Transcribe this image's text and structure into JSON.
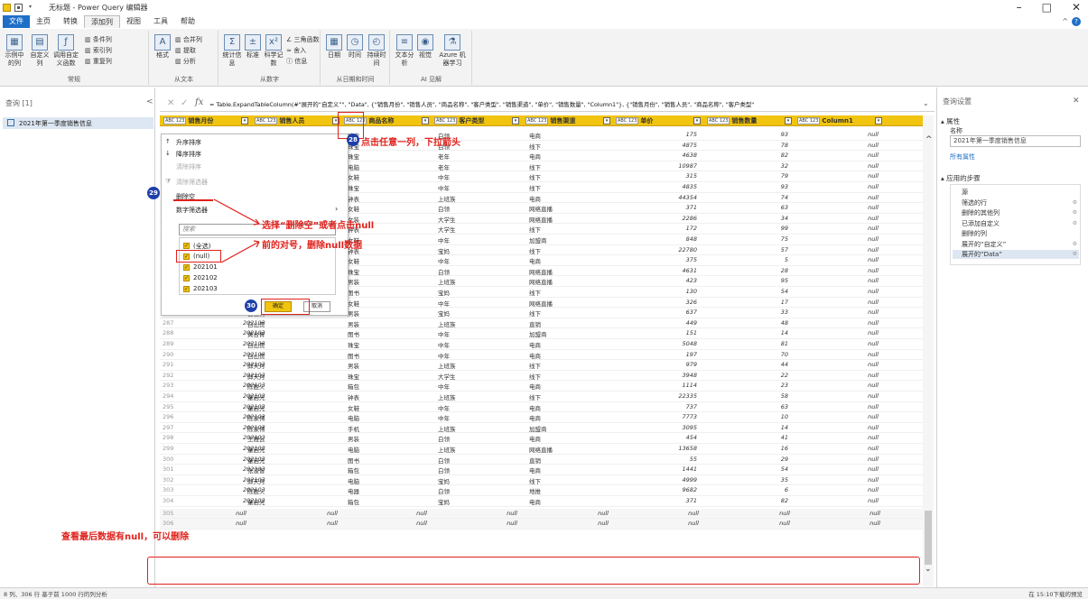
{
  "window": {
    "title": "无标题 - Power Query 编辑器",
    "minimize": "–",
    "maximize": "□",
    "close": "✕"
  },
  "menu": {
    "tabs": [
      "文件",
      "主页",
      "转换",
      "添加列",
      "视图",
      "工具",
      "帮助"
    ],
    "help_icon": "?",
    "collapse_icon": "^"
  },
  "ribbon": {
    "groups": [
      {
        "label": "常规",
        "buttons": [
          "示例中的列",
          "自定义列",
          "调用自定义函数",
          "条件列",
          "索引列",
          "重复列"
        ]
      },
      {
        "label": "从文本",
        "buttons": [
          "格式",
          "合并列",
          "提取",
          "分析"
        ]
      },
      {
        "label": "从数字",
        "buttons": [
          "统计信息",
          "标准",
          "科学记数",
          "三角函数",
          "舍入",
          "信息"
        ]
      },
      {
        "label": "从日期和时间",
        "buttons": [
          "日期",
          "时间",
          "持续时间"
        ]
      },
      {
        "label": "AI 见解",
        "buttons": [
          "文本分析",
          "视觉",
          "Azure 机器学习"
        ]
      }
    ]
  },
  "queries_panel": {
    "title": "查询 [1]",
    "collapse": "<",
    "items": [
      "2021年第一季度销售信息"
    ]
  },
  "formula_bar": {
    "cancel": "✕",
    "confirm": "✓",
    "fx": "fx",
    "text": "= Table.ExpandTableColumn(#\"展开的“自定义”\", \"Data\", {\"销售月份\", \"销售人员\", \"商品名称\", \"客户类型\", \"销售渠道\", \"单价\", \"销售数量\", \"Column1\"}, {\"销售月份\", \"销售人员\", \"商品名称\", \"客户类型\"",
    "expand": "⌄"
  },
  "grid": {
    "columns": [
      {
        "type_icon": "ABC 123",
        "name": "销售月份"
      },
      {
        "type_icon": "ABC 123",
        "name": "销售人员"
      },
      {
        "type_icon": "ABC 123",
        "name": "商品名称"
      },
      {
        "type_icon": "ABC 123",
        "name": "客户类型"
      },
      {
        "type_icon": "ABC 123",
        "name": "销售渠道"
      },
      {
        "type_icon": "ABC 123",
        "name": "单价"
      },
      {
        "type_icon": "ABC 123",
        "name": "销售数量"
      },
      {
        "type_icon": "ABC 123",
        "name": "Column1"
      }
    ],
    "upper_rows": [
      {
        "product": "珠宝",
        "customer": "白领",
        "channel": "电商",
        "price": "175",
        "qty": "93",
        "c1": "null"
      },
      {
        "product": "珠宝",
        "customer": "白领",
        "channel": "线下",
        "price": "4875",
        "qty": "78",
        "c1": "null"
      },
      {
        "product": "珠宝",
        "customer": "老年",
        "channel": "电商",
        "price": "4638",
        "qty": "82",
        "c1": "null"
      },
      {
        "product": "电脑",
        "customer": "老年",
        "channel": "线下",
        "price": "10987",
        "qty": "32",
        "c1": "null"
      },
      {
        "product": "女鞋",
        "customer": "中年",
        "channel": "线下",
        "price": "315",
        "qty": "79",
        "c1": "null"
      },
      {
        "product": "珠宝",
        "customer": "中年",
        "channel": "线下",
        "price": "4835",
        "qty": "93",
        "c1": "null"
      },
      {
        "product": "钟表",
        "customer": "上班族",
        "channel": "电商",
        "price": "44354",
        "qty": "74",
        "c1": "null"
      },
      {
        "product": "女鞋",
        "customer": "白领",
        "channel": "网络直播",
        "price": "371",
        "qty": "63",
        "c1": "null"
      },
      {
        "product": "女装",
        "customer": "大学生",
        "channel": "网络直播",
        "price": "2286",
        "qty": "34",
        "c1": "null"
      },
      {
        "product": "钟表",
        "customer": "大学生",
        "channel": "线下",
        "price": "172",
        "qty": "99",
        "c1": "null"
      },
      {
        "product": "女鞋",
        "customer": "中年",
        "channel": "加盟商",
        "price": "848",
        "qty": "75",
        "c1": "null"
      },
      {
        "product": "钟表",
        "customer": "宝妈",
        "channel": "线下",
        "price": "22780",
        "qty": "57",
        "c1": "null"
      },
      {
        "product": "女鞋",
        "customer": "中年",
        "channel": "电商",
        "price": "375",
        "qty": "5",
        "c1": "null"
      },
      {
        "product": "珠宝",
        "customer": "白领",
        "channel": "网络直播",
        "price": "4631",
        "qty": "28",
        "c1": "null"
      },
      {
        "product": "男装",
        "customer": "上班族",
        "channel": "网络直播",
        "price": "423",
        "qty": "95",
        "c1": "null"
      },
      {
        "product": "图书",
        "customer": "宝妈",
        "channel": "线下",
        "price": "130",
        "qty": "54",
        "c1": "null"
      }
    ],
    "rows": [
      {
        "n": "285",
        "month": "202103",
        "person": "张凌智",
        "product": "女鞋",
        "customer": "中年",
        "channel": "网络直播",
        "price": "326",
        "qty": "17",
        "c1": "null"
      },
      {
        "n": "286",
        "month": "202103",
        "person": "白山贵",
        "product": "男装",
        "customer": "宝妈",
        "channel": "线下",
        "price": "637",
        "qty": "33",
        "c1": "null"
      },
      {
        "n": "287",
        "month": "202103",
        "person": "白山贵",
        "product": "男装",
        "customer": "上班族",
        "channel": "直销",
        "price": "449",
        "qty": "48",
        "c1": "null"
      },
      {
        "n": "288",
        "month": "202103",
        "person": "黄台胃",
        "product": "图书",
        "customer": "中年",
        "channel": "加盟商",
        "price": "151",
        "qty": "14",
        "c1": "null"
      },
      {
        "n": "289",
        "month": "202103",
        "person": "白山贵",
        "product": "珠宝",
        "customer": "中年",
        "channel": "电商",
        "price": "5048",
        "qty": "81",
        "c1": "null"
      },
      {
        "n": "290",
        "month": "202103",
        "person": "白山贵",
        "product": "图书",
        "customer": "中年",
        "channel": "电商",
        "price": "197",
        "qty": "70",
        "c1": "null"
      },
      {
        "n": "291",
        "month": "202103",
        "person": "邱天月",
        "product": "男装",
        "customer": "上班族",
        "channel": "线下",
        "price": "979",
        "qty": "44",
        "c1": "null"
      },
      {
        "n": "292",
        "month": "202103",
        "person": "邱天月",
        "product": "珠宝",
        "customer": "大学生",
        "channel": "线下",
        "price": "3948",
        "qty": "22",
        "c1": "null"
      },
      {
        "n": "293",
        "month": "202103",
        "person": "陈胜火",
        "product": "箱包",
        "customer": "中年",
        "channel": "电商",
        "price": "1114",
        "qty": "23",
        "c1": "null"
      },
      {
        "n": "294",
        "month": "202103",
        "person": "童启光",
        "product": "钟表",
        "customer": "上班族",
        "channel": "线下",
        "price": "22335",
        "qty": "58",
        "c1": "null"
      },
      {
        "n": "295",
        "month": "202103",
        "person": "童启光",
        "product": "女鞋",
        "customer": "中年",
        "channel": "电商",
        "price": "737",
        "qty": "63",
        "c1": "null"
      },
      {
        "n": "296",
        "month": "202103",
        "person": "陈家伟",
        "product": "电脑",
        "customer": "中年",
        "channel": "电商",
        "price": "7773",
        "qty": "10",
        "c1": "null"
      },
      {
        "n": "297",
        "month": "202103",
        "person": "陈家伟",
        "product": "手机",
        "customer": "上班族",
        "channel": "加盟商",
        "price": "3095",
        "qty": "14",
        "c1": "null"
      },
      {
        "n": "298",
        "month": "202103",
        "person": "王雅云",
        "product": "男装",
        "customer": "白领",
        "channel": "电商",
        "price": "454",
        "qty": "41",
        "c1": "null"
      },
      {
        "n": "299",
        "month": "202103",
        "person": "童启光",
        "product": "电脑",
        "customer": "上班族",
        "channel": "网络直播",
        "price": "13658",
        "qty": "16",
        "c1": "null"
      },
      {
        "n": "300",
        "month": "202103",
        "person": "童启光",
        "product": "图书",
        "customer": "白领",
        "channel": "直销",
        "price": "55",
        "qty": "29",
        "c1": "null"
      },
      {
        "n": "301",
        "month": "202103",
        "person": "张凌智",
        "product": "箱包",
        "customer": "白领",
        "channel": "电商",
        "price": "1441",
        "qty": "54",
        "c1": "null"
      },
      {
        "n": "302",
        "month": "202103",
        "person": "邱天月",
        "product": "电脑",
        "customer": "宝妈",
        "channel": "线下",
        "price": "4999",
        "qty": "35",
        "c1": "null"
      },
      {
        "n": "303",
        "month": "202103",
        "person": "陈胜火",
        "product": "电器",
        "customer": "白领",
        "channel": "地推",
        "price": "9682",
        "qty": "6",
        "c1": "null"
      },
      {
        "n": "304",
        "month": "202103",
        "person": "童启光",
        "product": "箱包",
        "customer": "宝妈",
        "channel": "电商",
        "price": "371",
        "qty": "82",
        "c1": "null"
      }
    ],
    "null_rows": [
      {
        "n": "305",
        "v": "null"
      },
      {
        "n": "306",
        "v": "null"
      }
    ]
  },
  "filter_menu": {
    "sort_asc": "升序排序",
    "sort_desc": "降序排序",
    "clear_sort": "清除排序",
    "clear_filter": "清除筛选器",
    "remove_empty": "删除空",
    "number_filters": "数字筛选器",
    "submenu_arrow": "›",
    "search_placeholder": "搜索",
    "options": [
      "(全选)",
      "(null)",
      "202101",
      "202102",
      "202103"
    ],
    "ok": "确定",
    "cancel": "取消"
  },
  "settings_panel": {
    "title": "查询设置",
    "close": "✕",
    "properties_heading": "属性",
    "name_label": "名称",
    "name_value": "2021年第一季度销售信息",
    "all_properties": "所有属性",
    "steps_heading": "应用的步骤",
    "steps": [
      "源",
      "筛选的行",
      "删除的其他列",
      "已添加自定义",
      "删除的列",
      "展开的“自定义”",
      "展开的“Data”"
    ]
  },
  "status": {
    "left": "8 列、306 行   基于前 1000 行的列分析",
    "right": "在 15:10下载的预览"
  },
  "annotations": {
    "badge_28": "28",
    "text_28": "点击任意一列，下拉箭头",
    "badge_29": "29",
    "badge_30": "30",
    "text_29_line1": "选择“删除空”或者点击null",
    "text_29_line2": "前的对号，删除null数据",
    "text_bottom": "查看最后数据有null，可以删除"
  },
  "colors": {
    "header_yellow": "#f1c40f",
    "accent_blue": "#1f6fc7",
    "annotation_red": "#e0211c",
    "badge_navy": "#1f3fa8"
  }
}
